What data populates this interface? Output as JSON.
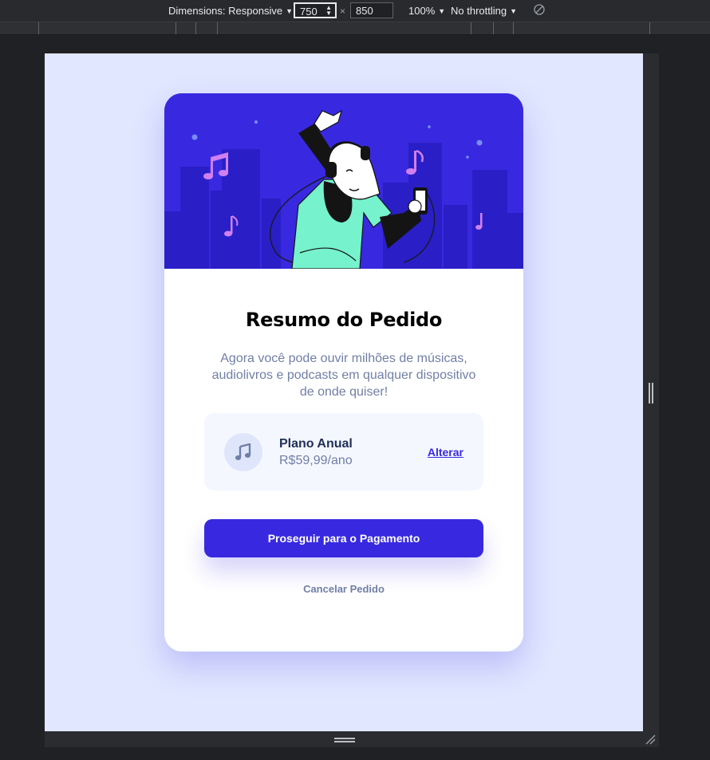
{
  "devtools": {
    "dimensions_label": "Dimensions: Responsive",
    "width_value": "750",
    "separator": "×",
    "height_value": "850",
    "zoom_label": "100%",
    "throttling_label": "No throttling"
  },
  "card": {
    "title": "Resumo do Pedido",
    "description": "Agora você pode ouvir milhões de músicas, audiolivros e podcasts em qualquer dispositivo de onde quiser!",
    "plan": {
      "icon": "music-note-icon",
      "name": "Plano Anual",
      "price": "R$59,99/ano",
      "change_label": "Alterar"
    },
    "pay_label": "Proseguir para o Pagamento",
    "cancel_label": "Cancelar Pedido"
  },
  "colors": {
    "accent": "#3829e0",
    "page_bg": "#e1e7ff",
    "plan_bg": "#f5f7ff",
    "text_muted": "#717fa6",
    "illustration_teal": "#76f2cd"
  }
}
